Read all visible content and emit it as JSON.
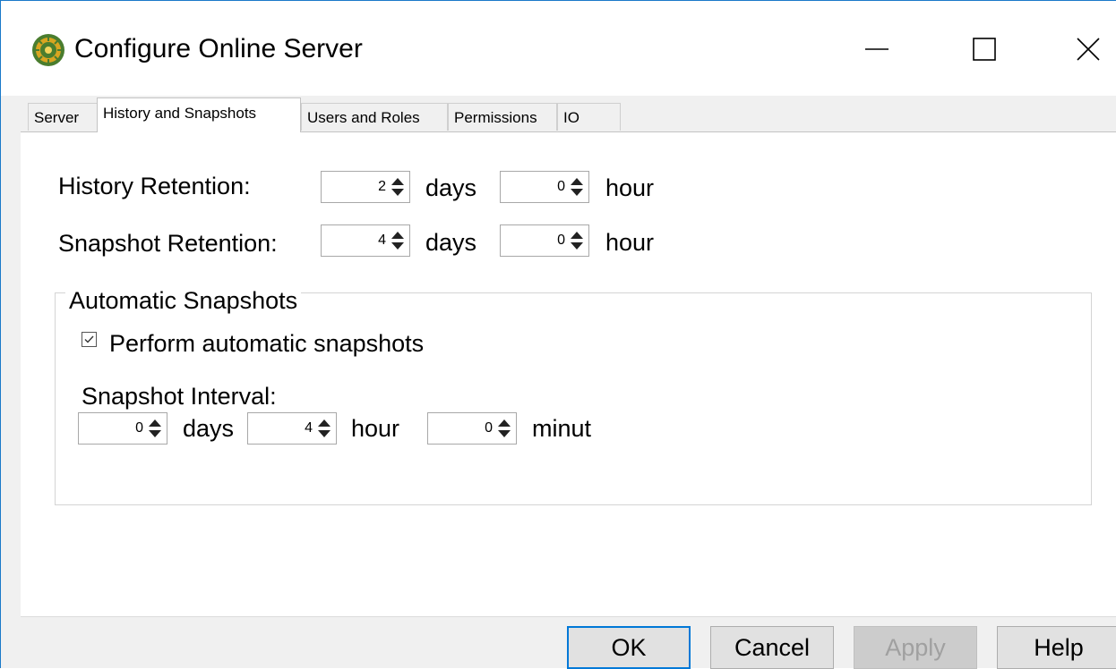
{
  "window": {
    "title": "Configure Online Server",
    "controls": {
      "minimize_icon": "minimize-icon",
      "maximize_icon": "maximize-icon",
      "close_icon": "close-icon"
    }
  },
  "tabs": [
    {
      "label": "Server",
      "active": false
    },
    {
      "label": "History and Snapshots",
      "active": true
    },
    {
      "label": "Users and Roles",
      "active": false
    },
    {
      "label": "Permissions",
      "active": false
    },
    {
      "label": "IO",
      "active": false
    }
  ],
  "history": {
    "label": "History Retention:",
    "days_value": "2",
    "days_unit": "days",
    "hours_value": "0",
    "hours_unit": "hour"
  },
  "snapshot": {
    "label": "Snapshot Retention:",
    "days_value": "4",
    "days_unit": "days",
    "hours_value": "0",
    "hours_unit": "hour"
  },
  "automatic": {
    "group_title": "Automatic Snapshots",
    "checkbox_label": "Perform automatic snapshots",
    "checkbox_checked": true,
    "interval_label": "Snapshot Interval:",
    "days_value": "0",
    "days_unit": "days",
    "hours_value": "4",
    "hours_unit": "hour",
    "minutes_value": "0",
    "minutes_unit": "minut"
  },
  "buttons": {
    "ok": "OK",
    "cancel": "Cancel",
    "apply": "Apply",
    "help": "Help"
  },
  "colors": {
    "accent": "#0078d7",
    "title_border": "#1a79c9",
    "dialog_bg": "#f0f0f0"
  }
}
